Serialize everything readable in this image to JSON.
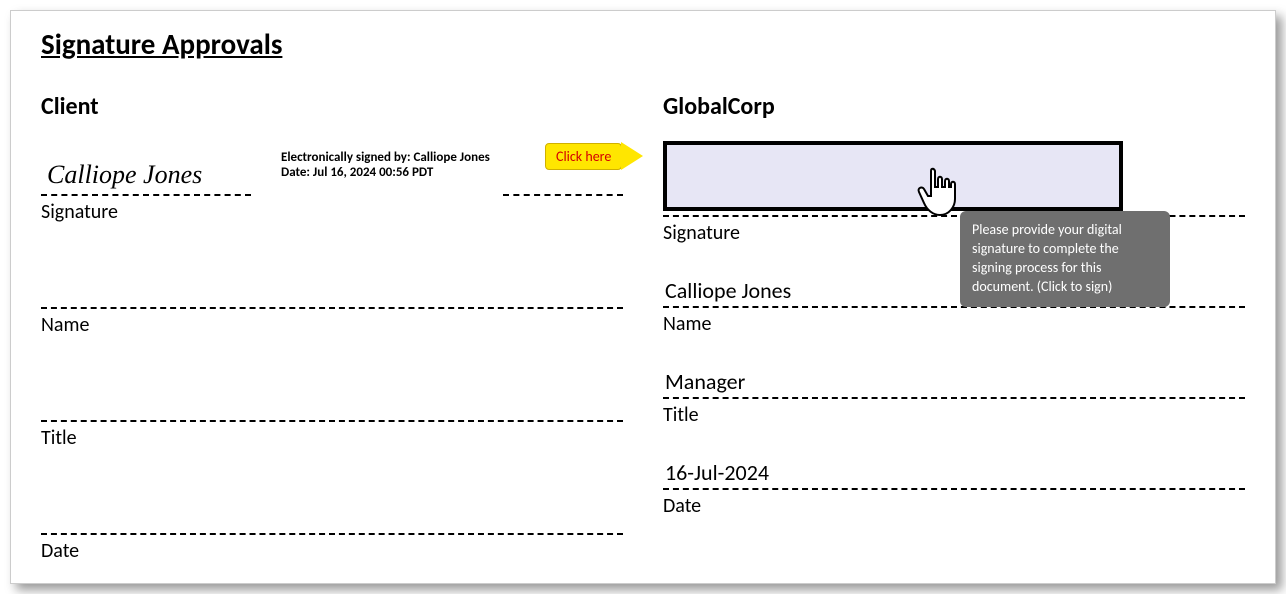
{
  "heading": "Signature Approvals",
  "callout_text": "Click here",
  "tooltip_text": "Please provide your digital signature to complete the signing process for this document. (Click to sign)",
  "left": {
    "party": "Client",
    "signature_name": "Calliope Jones",
    "sig_meta_line1": "Electronically signed by: Calliope Jones",
    "sig_meta_line2": "Date: Jul 16, 2024 00:56 PDT",
    "labels": {
      "signature": "Signature",
      "name": "Name",
      "title": "Title",
      "date": "Date"
    },
    "name_value": "",
    "title_value": "",
    "date_value": ""
  },
  "right": {
    "party": "GlobalCorp",
    "labels": {
      "signature": "Signature",
      "name": "Name",
      "title": "Title",
      "date": "Date"
    },
    "name_value": "Calliope Jones",
    "title_value": "Manager",
    "date_value": "16-Jul-2024"
  }
}
